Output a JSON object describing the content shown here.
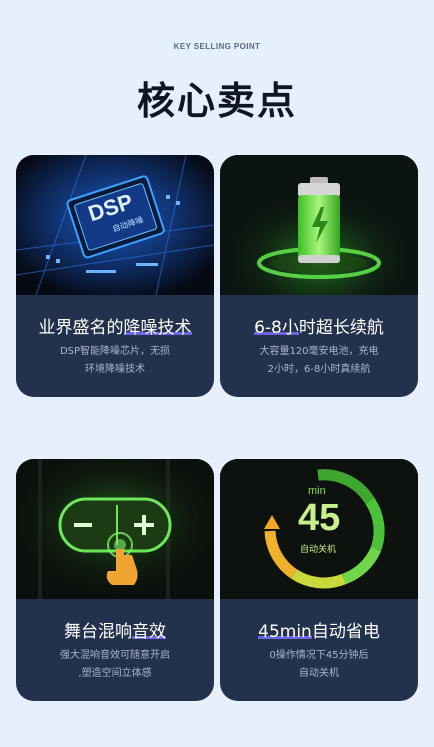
{
  "header": {
    "subtitle": "KEY SELLING POINT",
    "title": "核心卖点"
  },
  "cards": [
    {
      "title_pre": "业界盛名的",
      "title_hl": "降噪技术",
      "desc_line1": "DSP智能降噪芯片，无损",
      "desc_line2": "环境降噪技术",
      "chip_text": "DSP",
      "chip_sub": "自动降噪"
    },
    {
      "title_pre": "",
      "title_hl": "6-8小",
      "title_post": "时超长续航",
      "desc_line1": "大容量120毫安电池，充电",
      "desc_line2": "2小时，6-8小时真续航"
    },
    {
      "title_pre": "舞台混响",
      "title_hl": "音效",
      "desc_line1": "强大混响音效可随意开启",
      "desc_line2": ",塑造空间立体感"
    },
    {
      "title_pre": "",
      "title_hl": "45min",
      "title_post": "自动省电",
      "desc_line1": "0操作情况下45分钟后",
      "desc_line2": "自动关机",
      "gauge_unit": "min",
      "gauge_value": "45",
      "gauge_label": "自动关机"
    }
  ],
  "colors": {
    "background": "#e6effc",
    "card": "#22324d",
    "highlight": "#6c64e6",
    "green": "#5ee04a",
    "orange": "#f6a623"
  }
}
